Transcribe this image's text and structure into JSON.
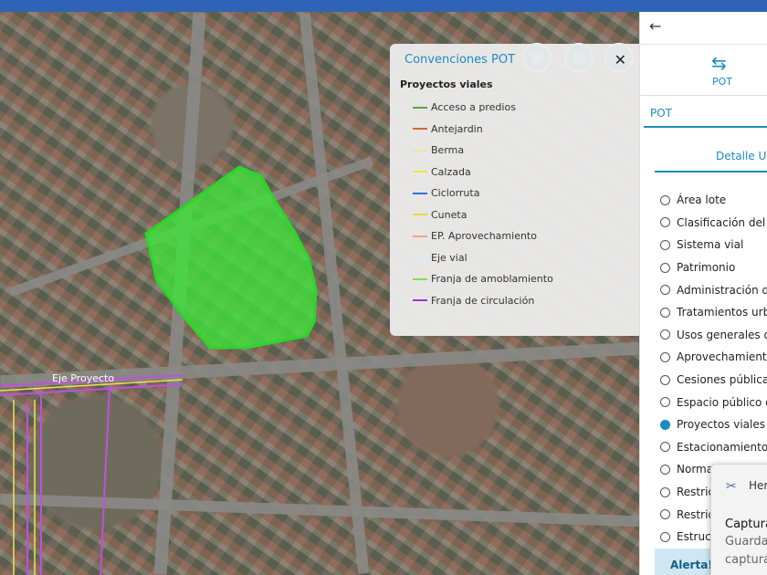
{
  "map": {
    "road_label": "Eje Proyecto",
    "highlight_color": "#3ee63a",
    "buttons": [
      {
        "name": "briefcase-icon",
        "glyph": "▣"
      },
      {
        "name": "map-icon",
        "glyph": "▤"
      },
      {
        "name": "home-icon",
        "glyph": "⌂"
      }
    ]
  },
  "legend": {
    "title": "Convenciones POT",
    "close": "✕",
    "section": "Proyectos viales",
    "items": [
      {
        "label": "Acceso a predios",
        "color": "#56a93a"
      },
      {
        "label": "Antejardin",
        "color": "#d9662d"
      },
      {
        "label": "Berma",
        "color": "#f2e39a"
      },
      {
        "label": "Calzada",
        "color": "#f3e24a"
      },
      {
        "label": "Ciclorruta",
        "color": "#2f6fd6"
      },
      {
        "label": "Cuneta",
        "color": "#f0d93a"
      },
      {
        "label": "EP. Aprovechamiento",
        "color": "#f2a48a"
      },
      {
        "label": "Eje vial",
        "color": "#d6ecf2"
      },
      {
        "label": "Franja de amoblamiento",
        "color": "#7fe04a"
      },
      {
        "label": "Franja de circulación",
        "color": "#a234d6"
      }
    ]
  },
  "panel": {
    "back": "←",
    "pot_icon": "⇆",
    "pot_label": "POT",
    "sub_tab": "POT",
    "detalle": "Detalle Ur",
    "items": [
      {
        "label": "Área lote",
        "selected": false
      },
      {
        "label": "Clasificación del",
        "selected": false
      },
      {
        "label": "Sistema vial",
        "selected": false
      },
      {
        "label": "Patrimonio",
        "selected": false
      },
      {
        "label": "Administración de",
        "selected": false
      },
      {
        "label": "Tratamientos urb",
        "selected": false
      },
      {
        "label": "Usos generales d",
        "selected": false
      },
      {
        "label": "Aprovechamiento",
        "selected": false
      },
      {
        "label": "Cesiones pública",
        "selected": false
      },
      {
        "label": "Espacio público d",
        "selected": false
      },
      {
        "label": "Proyectos viales",
        "selected": true
      },
      {
        "label": "Estacionamientos",
        "selected": false
      },
      {
        "label": "Norma",
        "selected": false
      },
      {
        "label": "Restric",
        "selected": false
      },
      {
        "label": "Restric",
        "selected": false
      },
      {
        "label": "Estruc",
        "selected": false
      }
    ],
    "alert": "Alerta!"
  },
  "toast": {
    "app": "Her",
    "title": "Captura",
    "line1": "Guarda",
    "line2": "captura"
  }
}
